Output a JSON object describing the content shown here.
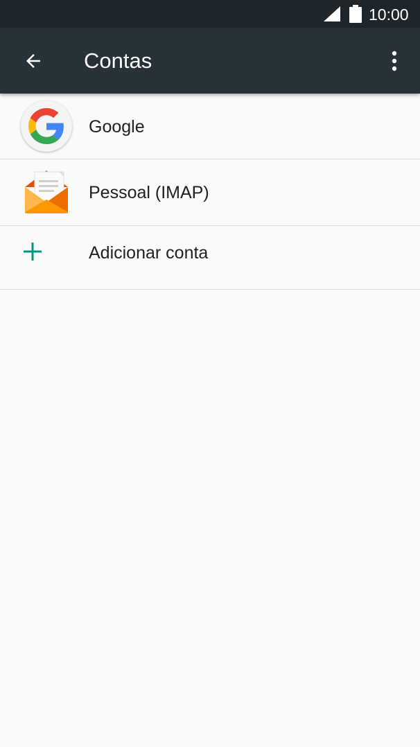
{
  "status_bar": {
    "time": "10:00",
    "signal_icon": "signal-icon",
    "battery_icon": "battery-icon"
  },
  "app_bar": {
    "title": "Contas",
    "back_icon": "arrow-back-icon",
    "menu_icon": "more-vert-icon"
  },
  "accounts": [
    {
      "label": "Google",
      "icon": "google-icon"
    },
    {
      "label": "Pessoal (IMAP)",
      "icon": "email-envelope-icon"
    }
  ],
  "add_account": {
    "label": "Adicionar conta",
    "icon": "plus-icon"
  },
  "colors": {
    "status_bar": "#1f262b",
    "app_bar": "#263238",
    "background": "#fafafa",
    "accent": "#009688",
    "text": "#212121"
  }
}
